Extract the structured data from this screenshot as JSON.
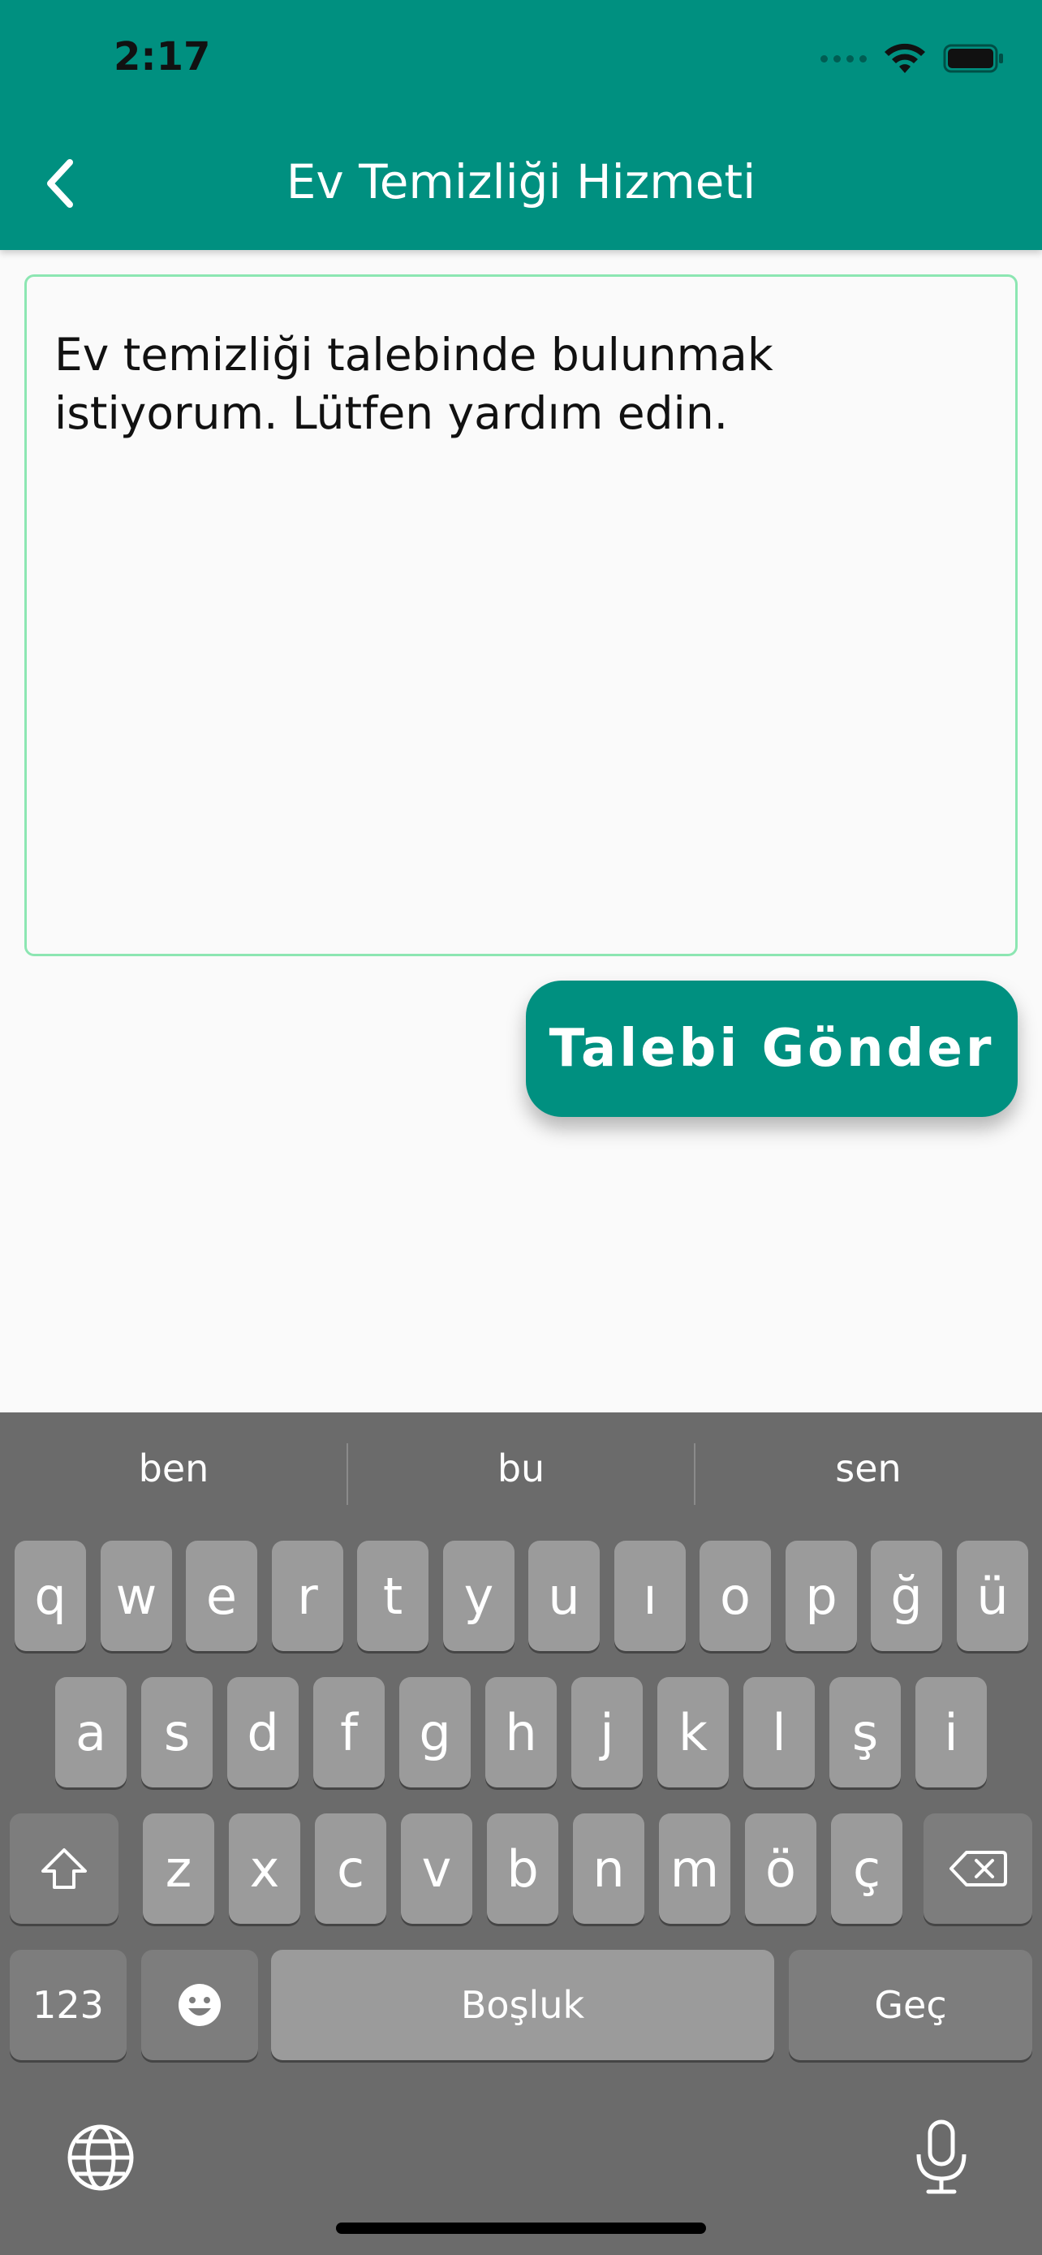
{
  "status_bar": {
    "time": "2:17"
  },
  "app_bar": {
    "title": "Ev Temizliği Hizmeti",
    "back_icon": "chevron-left-icon"
  },
  "request_form": {
    "text_value": "Ev temizliği talebinde bulunmak istiyorum. Lütfen yardım edin.",
    "submit_label": "Talebi Gönder"
  },
  "colors": {
    "primary": "#009080",
    "field_border": "#8ce6b2",
    "keyboard_bg": "#6b6b6b"
  },
  "keyboard": {
    "suggestions": [
      "ben",
      "bu",
      "sen"
    ],
    "row1": [
      "q",
      "w",
      "e",
      "r",
      "t",
      "y",
      "u",
      "ı",
      "o",
      "p",
      "ğ",
      "ü"
    ],
    "row2": [
      "a",
      "s",
      "d",
      "f",
      "g",
      "h",
      "j",
      "k",
      "l",
      "ş",
      "i"
    ],
    "row3": [
      "z",
      "x",
      "c",
      "v",
      "b",
      "n",
      "m",
      "ö",
      "ç"
    ],
    "numbers_label": "123",
    "space_label": "Boşluk",
    "return_label": "Geç"
  }
}
